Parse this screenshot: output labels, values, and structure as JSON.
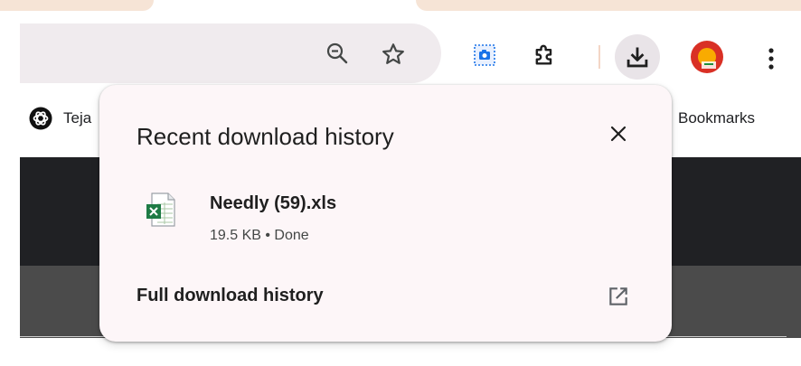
{
  "toolbar": {
    "icons": [
      "zoom-out-icon",
      "star-icon",
      "google-lens-icon",
      "extensions-icon",
      "download-icon",
      "avatar-icon",
      "more-menu-icon"
    ]
  },
  "bookmarks": {
    "left_item": {
      "label": "Teja",
      "icon": "chatgpt-icon"
    },
    "right_item": {
      "label": "Bookmarks"
    }
  },
  "download_popup": {
    "title": "Recent download history",
    "close_icon": "close-icon",
    "items": [
      {
        "name": "Needly (59).xls",
        "meta": "19.5 KB • Done",
        "icon": "excel-file-icon"
      }
    ],
    "footer_label": "Full download history",
    "footer_icon": "open-in-new-icon"
  },
  "colors": {
    "accent_tab": "#f6e4d6",
    "popup_bg": "#fdf6f8",
    "omnibox_bg": "#f0ebee",
    "dark_band": "#202124",
    "gray_band": "#4b4b4b",
    "lens_blue": "#1a73e8",
    "excel_green": "#1e7b45"
  }
}
